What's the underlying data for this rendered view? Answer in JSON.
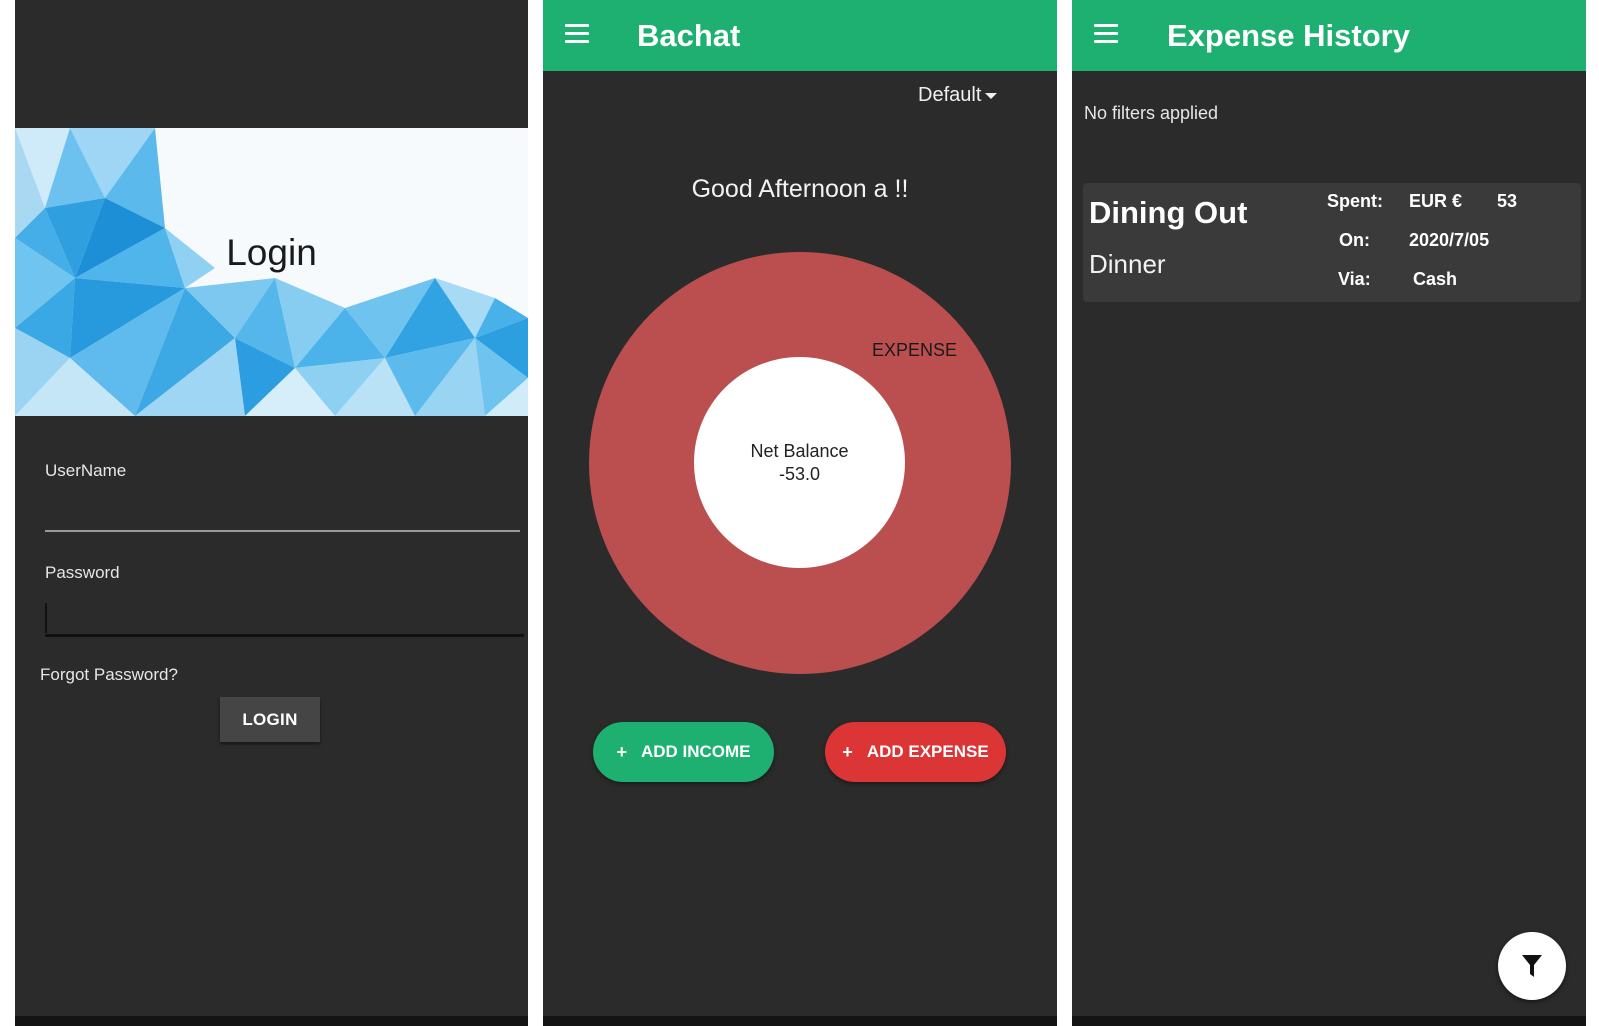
{
  "login_screen": {
    "title": "Login",
    "username_label": "UserName",
    "password_label": "Password",
    "forgot_password": "Forgot Password?",
    "login_button": "LOGIN"
  },
  "dashboard_screen": {
    "app_title": "Bachat",
    "account_selector": "Default",
    "greeting": "Good Afternoon a !!",
    "chart_segment_label": "EXPENSE",
    "net_balance_label": "Net Balance",
    "net_balance_value": "-53.0",
    "add_income_button": "ADD INCOME",
    "add_expense_button": "ADD EXPENSE",
    "colors": {
      "expense": "#bb4e4e",
      "accent": "#1db071",
      "expense_button": "#dc3535"
    }
  },
  "history_screen": {
    "title": "Expense History",
    "filters_status": "No filters applied",
    "entries": [
      {
        "category": "Dining Out",
        "note": "Dinner",
        "spent_label": "Spent:",
        "currency": "EUR €",
        "amount": "53",
        "on_label": "On:",
        "date": "2020/7/05",
        "via_label": "Via:",
        "method": "Cash"
      }
    ],
    "fab_icon": "filter-icon"
  },
  "icons": {
    "menu": "hamburger-menu-icon",
    "dropdown": "caret-down-icon",
    "plus": "plus-icon",
    "filter": "filter-icon"
  }
}
